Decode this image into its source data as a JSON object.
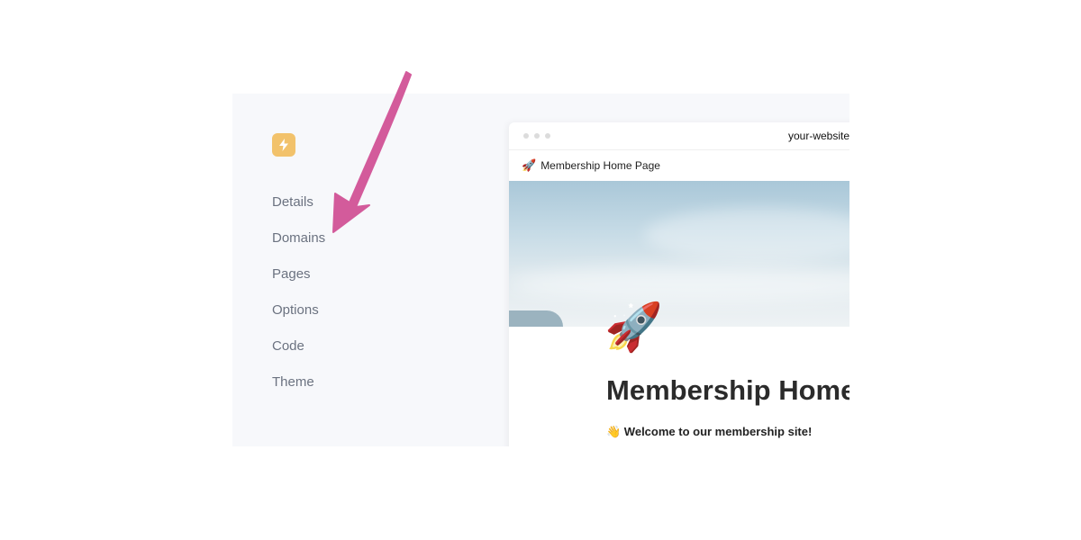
{
  "colors": {
    "accent_logo": "#f2c26b",
    "annotation_arrow": "#d35b9b",
    "sidebar_bg": "#f7f8fb",
    "nav_text": "#6b7280"
  },
  "sidebar": {
    "logo_icon": "lightning-icon",
    "items": [
      {
        "label": "Details"
      },
      {
        "label": "Domains"
      },
      {
        "label": "Pages"
      },
      {
        "label": "Options"
      },
      {
        "label": "Code"
      },
      {
        "label": "Theme"
      }
    ]
  },
  "preview": {
    "url": "your-website-",
    "tab": {
      "icon": "🚀",
      "title": "Membership Home Page"
    },
    "page_icon": "🚀",
    "page_title": "Membership Home Page",
    "welcome_text": "👋 Welcome to our membership site!"
  }
}
